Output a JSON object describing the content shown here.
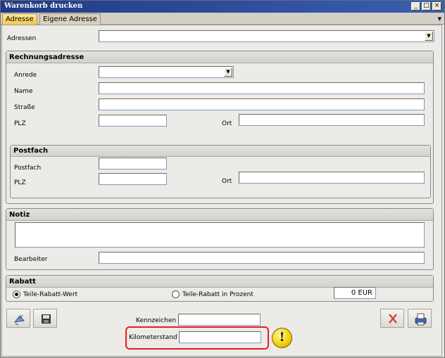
{
  "window": {
    "title": "Warenkorb drucken"
  },
  "tabs": [
    {
      "label": "Adresse",
      "active": true
    },
    {
      "label": "Eigene Adresse",
      "active": false
    }
  ],
  "adressen": {
    "label": "Adressen",
    "value": ""
  },
  "rechnungsadresse": {
    "title": "Rechnungsadresse",
    "anrede": {
      "label": "Anrede",
      "value": ""
    },
    "name": {
      "label": "Name",
      "value": ""
    },
    "strasse": {
      "label": "Straße",
      "value": ""
    },
    "plz": {
      "label": "PLZ",
      "value": ""
    },
    "ort": {
      "label": "Ort",
      "value": ""
    }
  },
  "postfach": {
    "title": "Postfach",
    "postfach": {
      "label": "Postfach",
      "value": ""
    },
    "plz": {
      "label": "PLZ",
      "value": ""
    },
    "ort": {
      "label": "Ort",
      "value": ""
    }
  },
  "notiz": {
    "title": "Notiz",
    "text": "",
    "bearbeiter": {
      "label": "Bearbeiter",
      "value": ""
    }
  },
  "rabatt": {
    "title": "Rabatt",
    "option_wert": "Teile-Rabatt-Wert",
    "option_prozent": "Teile-Rabatt in Prozent",
    "selected": "wert",
    "value": "0 EUR"
  },
  "bottom": {
    "kennzeichen": {
      "label": "Kennzeichen",
      "value": ""
    },
    "kilometerstand": {
      "label": "Kilometerstand",
      "value": ""
    },
    "warning_glyph": "!"
  },
  "icons": [
    "satellite-dish-icon",
    "save-icon",
    "cancel-x-icon",
    "printer-icon"
  ],
  "colors": {
    "highlight": "#e02020",
    "warning": "#f2cd00",
    "active_tab": "#f1c84b"
  }
}
